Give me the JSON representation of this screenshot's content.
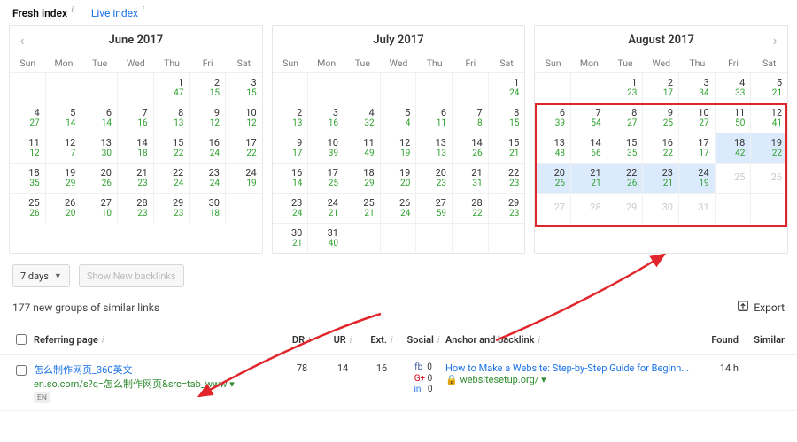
{
  "tabs": {
    "fresh": "Fresh index",
    "live": "Live index"
  },
  "dow": [
    "Sun",
    "Mon",
    "Tue",
    "Wed",
    "Thu",
    "Fri",
    "Sat"
  ],
  "calendars": [
    {
      "title": "June 2017",
      "has_prev": true,
      "has_next": false,
      "weeks": [
        [
          null,
          null,
          null,
          null,
          {
            "d": 1,
            "s": 47
          },
          {
            "d": 2,
            "s": 15
          },
          {
            "d": 3,
            "s": 15
          }
        ],
        [
          {
            "d": 4,
            "s": 27
          },
          {
            "d": 5,
            "s": 14
          },
          {
            "d": 6,
            "s": 14
          },
          {
            "d": 7,
            "s": 16
          },
          {
            "d": 8,
            "s": 13
          },
          {
            "d": 9,
            "s": 12
          },
          {
            "d": 10,
            "s": 12
          }
        ],
        [
          {
            "d": 11,
            "s": 12
          },
          {
            "d": 12,
            "s": 7
          },
          {
            "d": 13,
            "s": 30
          },
          {
            "d": 14,
            "s": 18
          },
          {
            "d": 15,
            "s": 22
          },
          {
            "d": 16,
            "s": 24
          },
          {
            "d": 17,
            "s": 22
          }
        ],
        [
          {
            "d": 18,
            "s": 35
          },
          {
            "d": 19,
            "s": 29
          },
          {
            "d": 20,
            "s": 26
          },
          {
            "d": 21,
            "s": 23
          },
          {
            "d": 22,
            "s": 24
          },
          {
            "d": 23,
            "s": 24
          },
          {
            "d": 24,
            "s": 19
          }
        ],
        [
          {
            "d": 25,
            "s": 26
          },
          {
            "d": 26,
            "s": 20
          },
          {
            "d": 27,
            "s": 10
          },
          {
            "d": 28,
            "s": 23
          },
          {
            "d": 29,
            "s": 23
          },
          {
            "d": 30,
            "s": 18
          },
          null
        ]
      ]
    },
    {
      "title": "July 2017",
      "has_prev": false,
      "has_next": false,
      "weeks": [
        [
          null,
          null,
          null,
          null,
          null,
          null,
          {
            "d": 1,
            "s": 24
          }
        ],
        [
          {
            "d": 2,
            "s": 13
          },
          {
            "d": 3,
            "s": 16
          },
          {
            "d": 4,
            "s": 32
          },
          {
            "d": 5,
            "s": 4
          },
          {
            "d": 6,
            "s": 11
          },
          {
            "d": 7,
            "s": 8
          },
          {
            "d": 8,
            "s": 15
          }
        ],
        [
          {
            "d": 9,
            "s": 17
          },
          {
            "d": 10,
            "s": 39
          },
          {
            "d": 11,
            "s": 49
          },
          {
            "d": 12,
            "s": 19
          },
          {
            "d": 13,
            "s": 13
          },
          {
            "d": 14,
            "s": 26
          },
          {
            "d": 15,
            "s": 21
          }
        ],
        [
          {
            "d": 16,
            "s": 14
          },
          {
            "d": 17,
            "s": 25
          },
          {
            "d": 18,
            "s": 29
          },
          {
            "d": 19,
            "s": 20
          },
          {
            "d": 20,
            "s": 23
          },
          {
            "d": 21,
            "s": 31
          },
          {
            "d": 22,
            "s": 23
          }
        ],
        [
          {
            "d": 23,
            "s": 24
          },
          {
            "d": 24,
            "s": 21
          },
          {
            "d": 25,
            "s": 21
          },
          {
            "d": 26,
            "s": 24
          },
          {
            "d": 27,
            "s": 59
          },
          {
            "d": 28,
            "s": 22
          },
          {
            "d": 29,
            "s": 23
          }
        ],
        [
          {
            "d": 30,
            "s": 21
          },
          {
            "d": 31,
            "s": 40
          },
          null,
          null,
          null,
          null,
          null
        ]
      ]
    },
    {
      "title": "August 2017",
      "has_prev": false,
      "has_next": true,
      "highlight_box": true,
      "weeks": [
        [
          null,
          null,
          {
            "d": 1,
            "s": 23
          },
          {
            "d": 2,
            "s": 17
          },
          {
            "d": 3,
            "s": 34
          },
          {
            "d": 4,
            "s": 33
          },
          {
            "d": 5,
            "s": 21
          }
        ],
        [
          {
            "d": 6,
            "s": 39
          },
          {
            "d": 7,
            "s": 54
          },
          {
            "d": 8,
            "s": 27
          },
          {
            "d": 9,
            "s": 25
          },
          {
            "d": 10,
            "s": 27
          },
          {
            "d": 11,
            "s": 50
          },
          {
            "d": 12,
            "s": 41
          }
        ],
        [
          {
            "d": 13,
            "s": 48
          },
          {
            "d": 14,
            "s": 66
          },
          {
            "d": 15,
            "s": 35
          },
          {
            "d": 16,
            "s": 22
          },
          {
            "d": 17,
            "s": 17
          },
          {
            "d": 18,
            "s": 42,
            "sel": true
          },
          {
            "d": 19,
            "s": 22,
            "sel": true
          }
        ],
        [
          {
            "d": 20,
            "s": 26,
            "sel": true
          },
          {
            "d": 21,
            "s": 21,
            "sel": true
          },
          {
            "d": 22,
            "s": 26,
            "sel": true
          },
          {
            "d": 23,
            "s": 21,
            "sel": true
          },
          {
            "d": 24,
            "s": 19,
            "sel": true
          },
          {
            "d": 25,
            "dis": true
          },
          {
            "d": 26,
            "dis": true
          }
        ],
        [
          {
            "d": 27,
            "dis": true
          },
          {
            "d": 28,
            "dis": true
          },
          {
            "d": 29,
            "dis": true
          },
          {
            "d": 30,
            "dis": true
          },
          {
            "d": 31,
            "dis": true
          },
          null,
          null
        ]
      ]
    }
  ],
  "controls": {
    "range_label": "7 days",
    "show_new_label": "Show New backlinks"
  },
  "summary_text": "177 new groups of similar links",
  "export_label": "Export",
  "columns": {
    "referring": "Referring page",
    "dr": "DR",
    "ur": "UR",
    "ext": "Ext.",
    "social": "Social",
    "anchor": "Anchor and backlink",
    "found": "Found",
    "similar": "Similar"
  },
  "row": {
    "title": "怎么制作网页_360英文",
    "url": "en.so.com/s?q=怎么制作网页&src=tab_www ▾",
    "lang": "EN",
    "dr": "78",
    "ur": "14",
    "ext": "16",
    "social": {
      "fb_label": "fb",
      "fb_val": "0",
      "gp_label": "G+",
      "gp_val": "0",
      "in_label": "in",
      "in_val": "0"
    },
    "anchor_title": "How to Make a Website: Step-by-Step Guide for Beginn...",
    "anchor_url": "websitesetup.org/ ▾",
    "found": "14 h",
    "similar": ""
  }
}
